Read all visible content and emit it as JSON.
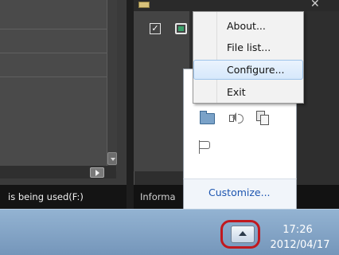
{
  "left_window": {
    "status_text": "is being used(F:)"
  },
  "right_window": {
    "status_text": "Informa"
  },
  "context_menu": {
    "items": [
      {
        "label": "About..."
      },
      {
        "label": "File list..."
      },
      {
        "label": "Configure..."
      },
      {
        "label": "Exit"
      }
    ],
    "hovered_item": "Configure..."
  },
  "tray_flyout": {
    "icons": [
      "folder-icon",
      "speaker-icon",
      "network-icon",
      "flag-icon"
    ],
    "customize_label": "Customize..."
  },
  "taskbar": {
    "clock_time": "17:26",
    "clock_date": "2012/04/17"
  },
  "colors": {
    "highlight_ring": "#c0191f",
    "link": "#1c55b0",
    "taskbar": "#7e9fc4"
  }
}
